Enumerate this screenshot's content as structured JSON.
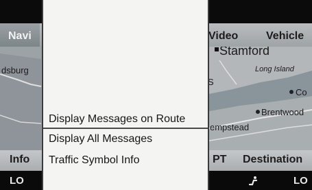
{
  "top_menu": {
    "navi": "Navi",
    "video": "Video",
    "vehicle": "Vehicle"
  },
  "map": {
    "labels": {
      "stamford": "Stamford",
      "long_island": "Long Island",
      "left_town": "dsburg",
      "s_letter": "S",
      "co": "Co",
      "brentwood": "Brentwood",
      "hempstead": "empstead"
    }
  },
  "bottom_menu": {
    "info": "Info",
    "pt": "PT",
    "destination": "Destination"
  },
  "status": {
    "left": "LO",
    "right": "LO"
  },
  "panel": {
    "items": [
      "Display Messages on Route",
      "Display All Messages",
      "Traffic Symbol Info"
    ],
    "selected_index": 0
  },
  "colors": {
    "panel_bg": "#f4f4f3",
    "map_bg": "#9da2a6",
    "status_bg": "#0a0a0a"
  }
}
